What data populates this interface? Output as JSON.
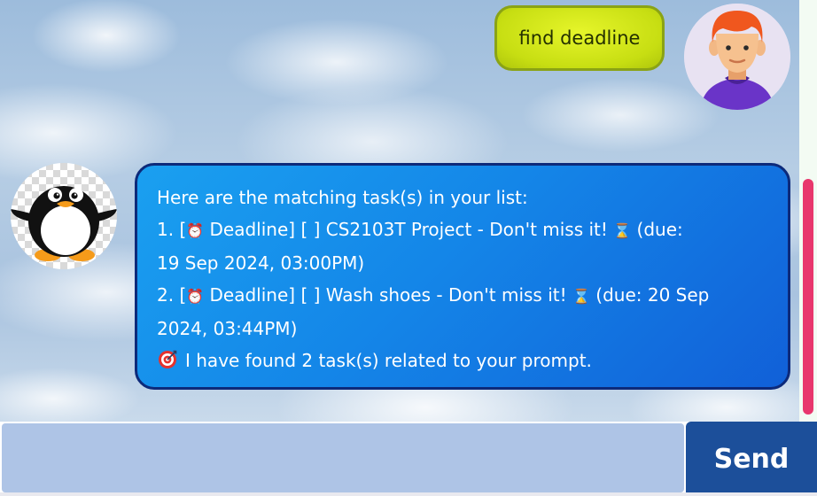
{
  "chat": {
    "user_message": "find deadline",
    "bot_response": {
      "intro": "Here are the matching task(s) in your list:",
      "tasks": [
        {
          "line1_prefix": "1. [",
          "line1_tag": " Deadline] [ ] CS2103T Project  - Don't miss it! ",
          "line1_suffix": " (due:",
          "line2": "19 Sep 2024, 03:00PM)"
        },
        {
          "line1_prefix": "2. [",
          "line1_tag": " Deadline] [ ] Wash shoes  - Don't miss it! ",
          "line1_suffix": " (due: 20 Sep",
          "line2": "2024, 03:44PM)"
        }
      ],
      "summary": "I have found 2 task(s) related to your prompt."
    }
  },
  "icons": {
    "alarm": "alarm-clock-icon",
    "hourglass": "hourglass-icon",
    "target": "target-icon",
    "user_avatar": "user-avatar",
    "bot_avatar": "penguin-avatar"
  },
  "input": {
    "value": "",
    "placeholder": ""
  },
  "send_button": {
    "label": "Send"
  },
  "colors": {
    "user_bubble": "#c7de12",
    "bot_bubble": "#1486e8",
    "send_button": "#1c4f9a",
    "input_background": "#aec4e6",
    "scrollbar_thumb": "#e8376d"
  }
}
